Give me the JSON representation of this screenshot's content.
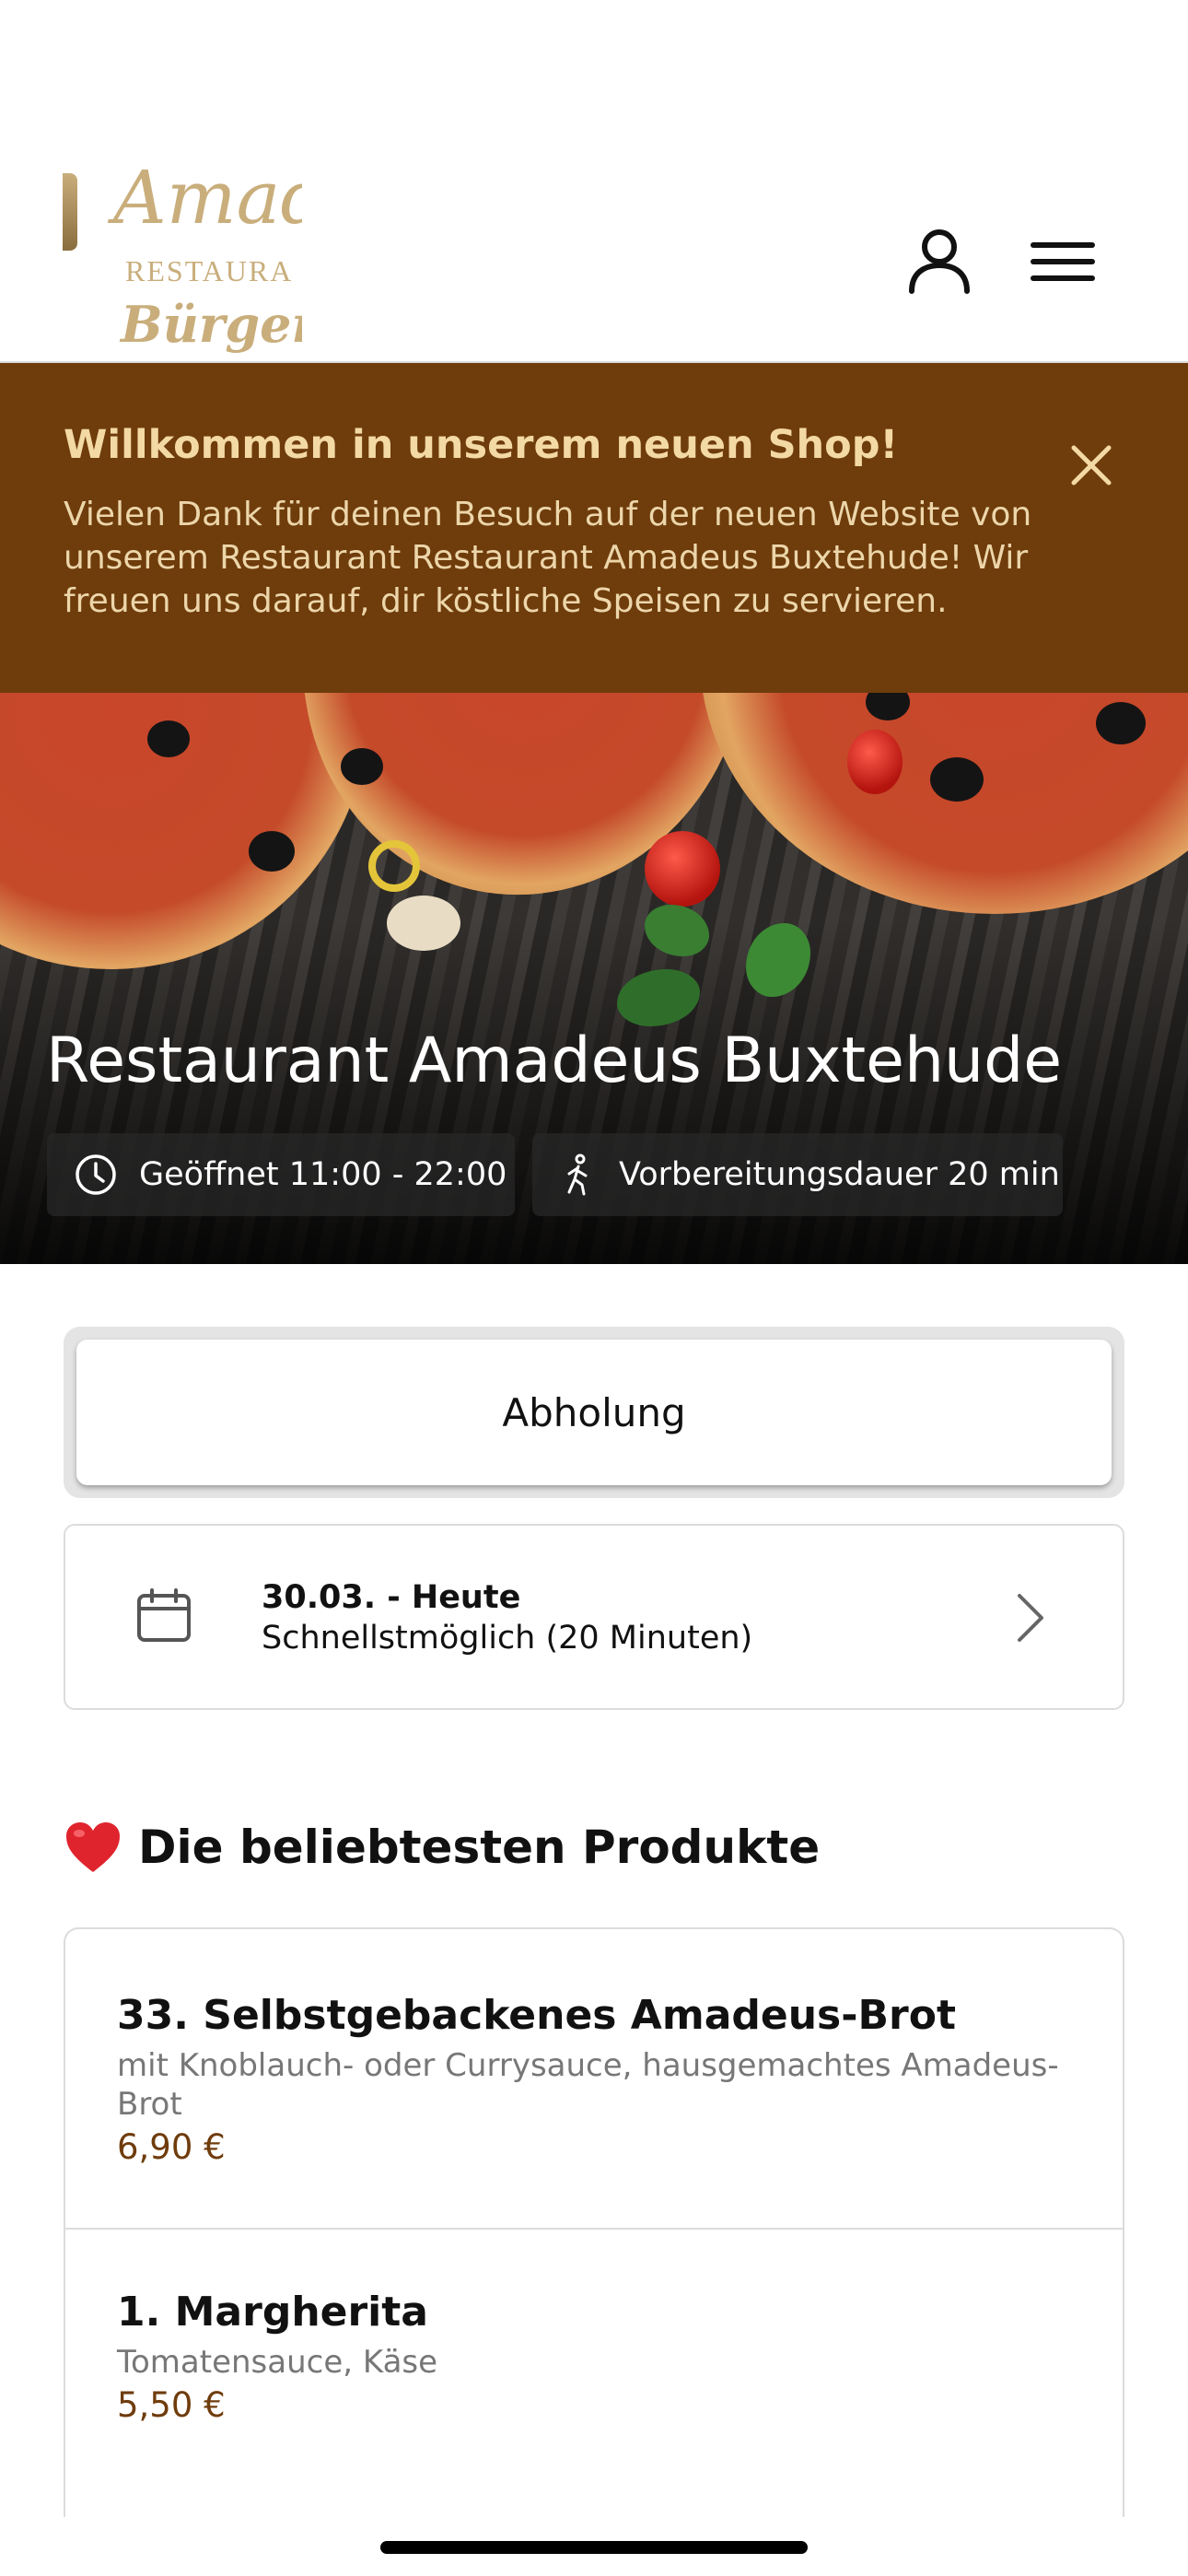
{
  "header": {
    "logo": {
      "line1": "Amad",
      "line2": "RESTAURA",
      "line3": "Bürger"
    },
    "icons": {
      "account": "user-icon",
      "menu": "hamburger-menu-icon"
    }
  },
  "banner": {
    "title": "Willkommen in unserem neuen Shop!",
    "text": "Vielen Dank für deinen Besuch auf der neuen Website von unserem Restaurant Restaurant Amadeus Buxtehude! Wir freuen uns darauf, dir köstliche Speisen zu servieren.",
    "close_icon": "close-icon",
    "background": "#6f3c0c"
  },
  "hero": {
    "restaurant_name": "Restaurant Amadeus Buxtehude",
    "opening_hours": "Geöffnet 11:00 - 22:00",
    "prep_time": "Vorbereitungsdauer 20 min"
  },
  "order": {
    "mode_label": "Abholung",
    "date_title": "30.03. - Heute",
    "date_subtitle": "Schnellstmöglich (20 Minuten)"
  },
  "popular": {
    "title": "Die beliebtesten Produkte",
    "products": [
      {
        "name": "33. Selbstgebackenes Amadeus-Brot",
        "description": "mit Knoblauch- oder Currysauce, hausgemachtes Amadeus-Brot",
        "price": "6,90 €"
      },
      {
        "name": "1. Margherita",
        "description": "Tomatensauce, Käse",
        "price": "5,50 €"
      }
    ]
  },
  "colors": {
    "accent": "#6f3c0c",
    "banner_title": "#f3d9a4",
    "logo": "#c9ae7c"
  }
}
